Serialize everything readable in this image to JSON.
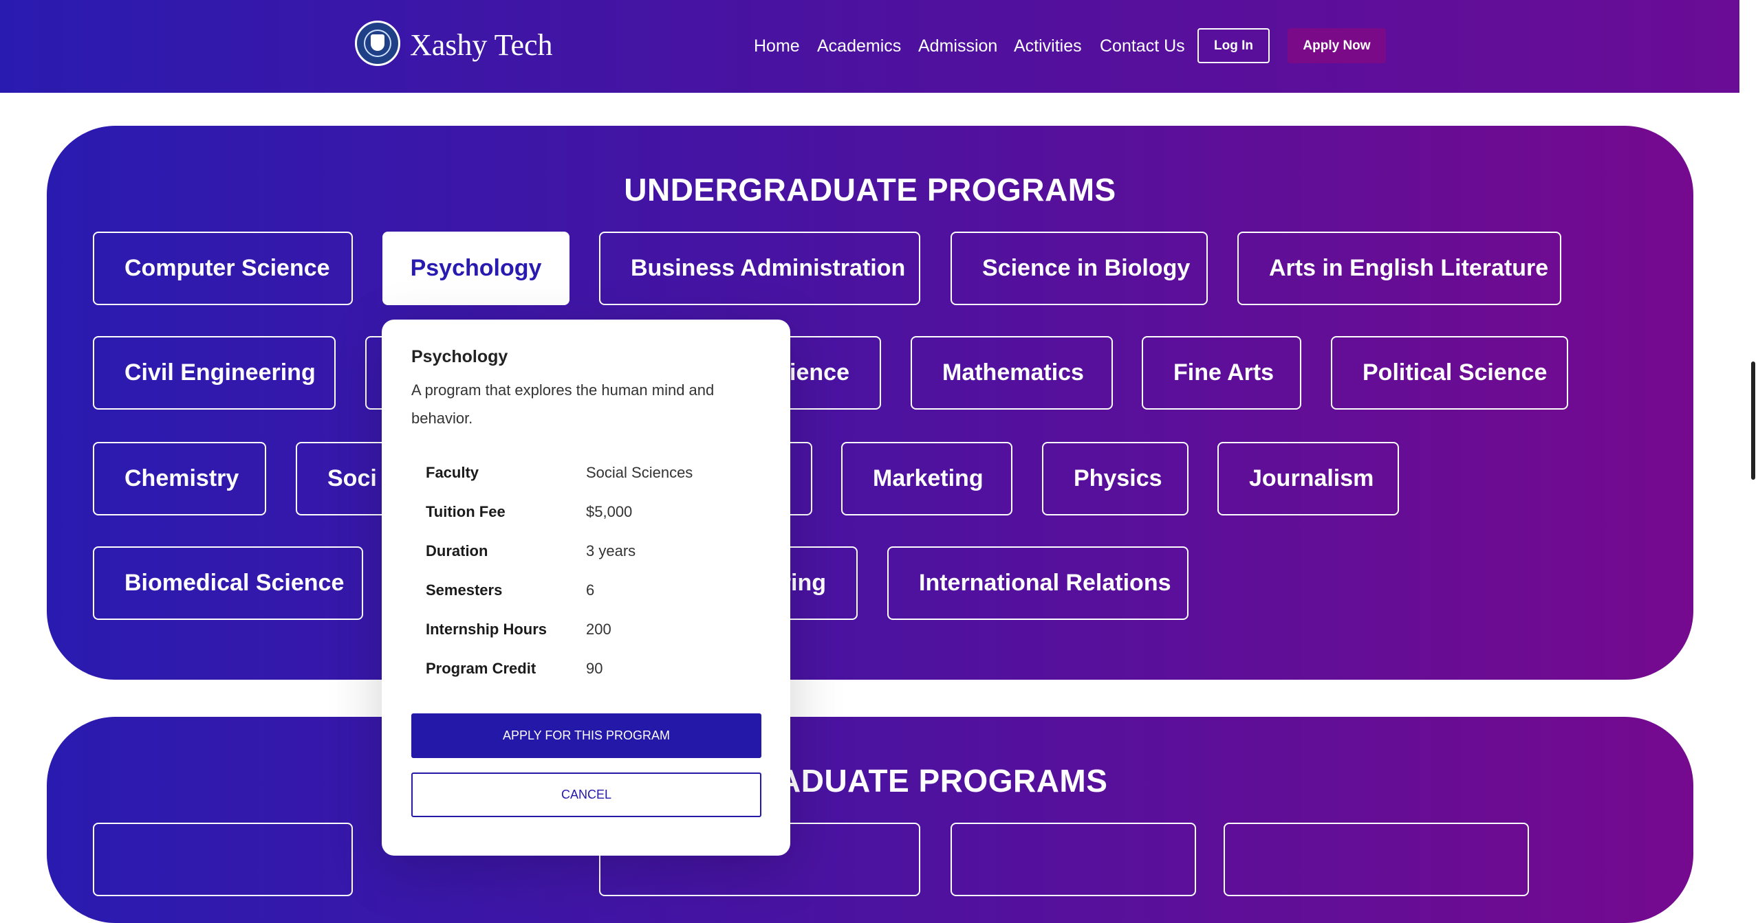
{
  "header": {
    "brand": "Xashy Tech",
    "nav": [
      "Home",
      "Academics",
      "Admission",
      "Activities",
      "Contact Us"
    ],
    "login_label": "Log In",
    "apply_label": "Apply Now"
  },
  "undergraduate": {
    "title": "UNDERGRADUATE PROGRAMS",
    "programs": [
      "Computer Science",
      "Psychology",
      "Business Administration",
      "Science in Biology",
      "Arts in English Literature",
      "Civil Engineering",
      "ience",
      "Mathematics",
      "Fine Arts",
      "Political Science",
      "Chemistry",
      "Soci",
      "Marketing",
      "Physics",
      "Journalism",
      "Biomedical Science",
      "ring",
      "International Relations"
    ],
    "selected": "Psychology"
  },
  "postgraduate": {
    "title_partial": "ADUATE PROGRAMS"
  },
  "popup": {
    "title": "Psychology",
    "description": "A program that explores the human mind and behavior.",
    "details": [
      {
        "label": "Faculty",
        "value": "Social Sciences"
      },
      {
        "label": "Tuition Fee",
        "value": "$5,000"
      },
      {
        "label": "Duration",
        "value": "3 years"
      },
      {
        "label": "Semesters",
        "value": "6"
      },
      {
        "label": "Internship Hours",
        "value": "200"
      },
      {
        "label": "Program Credit",
        "value": "90"
      }
    ],
    "apply_label": "APPLY FOR THIS PROGRAM",
    "cancel_label": "CANCEL"
  },
  "colors": {
    "gradient_start": "#2a1bb0",
    "gradient_end": "#750a8f",
    "apply_now_bg": "#7a0a87",
    "primary_button": "#2418a8"
  }
}
